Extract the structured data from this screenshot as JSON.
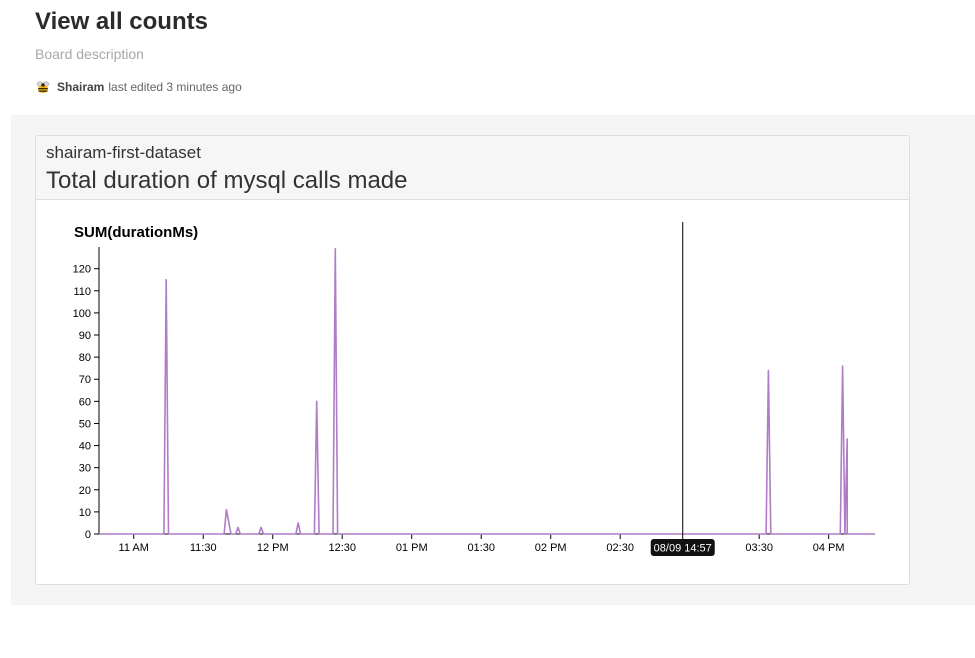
{
  "board": {
    "title": "View all counts",
    "description": "Board description",
    "user": "Shairam",
    "edited": "last edited 3 minutes ago",
    "avatar_icon": "bee-icon"
  },
  "panel": {
    "dataset": "shairam-first-dataset",
    "title": "Total duration of mysql calls made"
  },
  "chart_data": {
    "type": "line",
    "title": "SUM(durationMs)",
    "xlabel": "",
    "ylabel": "",
    "color": "#b07cc6",
    "ylim": [
      0,
      128
    ],
    "yticks": [
      0,
      10,
      20,
      30,
      40,
      50,
      60,
      70,
      80,
      90,
      100,
      110,
      120
    ],
    "xlim": [
      "10:45",
      "16:20"
    ],
    "xticks": [
      {
        "t": "11:00",
        "label": "11 AM"
      },
      {
        "t": "11:30",
        "label": "11:30"
      },
      {
        "t": "12:00",
        "label": "12 PM"
      },
      {
        "t": "12:30",
        "label": "12:30"
      },
      {
        "t": "13:00",
        "label": "01 PM"
      },
      {
        "t": "13:30",
        "label": "01:30"
      },
      {
        "t": "14:00",
        "label": "02 PM"
      },
      {
        "t": "14:30",
        "label": "02:30"
      },
      {
        "t": "15:30",
        "label": "03:30"
      },
      {
        "t": "16:00",
        "label": "04 PM"
      }
    ],
    "cursor": {
      "t": "14:57",
      "label": "08/09 14:57"
    },
    "series": [
      {
        "points": [
          [
            "10:45",
            0
          ],
          [
            "11:13",
            0
          ],
          [
            "11:14",
            115
          ],
          [
            "11:15",
            0
          ],
          [
            "11:39",
            0
          ],
          [
            "11:40",
            11
          ],
          [
            "11:42",
            0
          ],
          [
            "11:44",
            0
          ],
          [
            "11:45",
            3
          ],
          [
            "11:46",
            0
          ],
          [
            "11:54",
            0
          ],
          [
            "11:55",
            3
          ],
          [
            "11:56",
            0
          ],
          [
            "12:10",
            0
          ],
          [
            "12:11",
            5
          ],
          [
            "12:12",
            0
          ],
          [
            "12:18",
            0
          ],
          [
            "12:19",
            60
          ],
          [
            "12:20",
            0
          ],
          [
            "12:26",
            0
          ],
          [
            "12:27",
            129
          ],
          [
            "12:28",
            0
          ],
          [
            "15:33",
            0
          ],
          [
            "15:34",
            74
          ],
          [
            "15:35",
            0
          ],
          [
            "16:05",
            0
          ],
          [
            "16:06",
            76
          ],
          [
            "16:07",
            0
          ],
          [
            "16:08",
            43
          ],
          [
            "16:08",
            0
          ],
          [
            "16:20",
            0
          ]
        ]
      }
    ]
  }
}
